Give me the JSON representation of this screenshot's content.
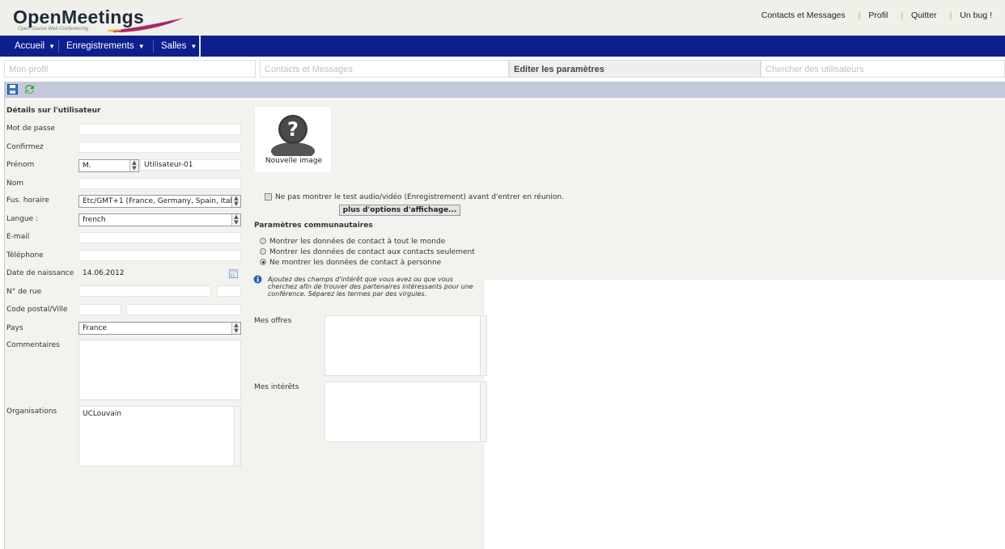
{
  "header": {
    "logo_title": "OpenMeetings",
    "logo_subtitle": "Open-Source Web-Conferencing",
    "links": [
      "Contacts et Messages",
      "Profil",
      "Quitter",
      "Un bug !"
    ]
  },
  "nav": {
    "items": [
      "Accueil",
      "Enregistrements",
      "Salles"
    ]
  },
  "tabs": [
    "Mon profil",
    "Contacts et Messages",
    "Editer les paramètres",
    "Chercher des utilisateurs"
  ],
  "active_tab": "Editer les paramètres",
  "toolbar": {
    "icons": [
      "save-icon",
      "refresh-icon"
    ]
  },
  "form": {
    "section_title": "Détails sur l'utilisateur",
    "password_label": "Mot de passe",
    "confirm_label": "Confirmez",
    "firstname_label": "Prénom",
    "salutation_value": "M.",
    "firstname_value": "Utilisateur-01",
    "lastname_label": "Nom",
    "timezone_label": "Fus. horaire",
    "timezone_value": "Etc/GMT+1 (France, Germany, Spain, Italy",
    "language_label": "Langue :",
    "language_value": "french",
    "email_label": "E-mail",
    "phone_label": "Téléphone",
    "birthdate_label": "Date de naissance",
    "birthdate_value": "14.06.2012",
    "street_label": "N° de rue",
    "zipcity_label": "Code postal/Ville",
    "country_label": "Pays",
    "country_value": "France",
    "comments_label": "Commentaires",
    "organisations_label": "Organisations",
    "organisations_value": "UCLouvain"
  },
  "profile": {
    "new_image_label": "Nouvelle image",
    "skip_av_test_label": "Ne pas montrer le test audio/vidéo (Enregistrement) avant d'entrer en réunion.",
    "more_options_button": "plus d'options d'affichage...",
    "community_title": "Paramètres communautaires",
    "radio_options": [
      "Montrer les données de contact à tout le monde",
      "Montrer les données de contact aux contacts seulement",
      "Ne montrer les données de contact à personne"
    ],
    "selected_radio": 2,
    "info_lines": [
      "Ajoutez des champs d'intérêt que vous avez ou que vous",
      "cherchez afin de trouver des partenaires intéressants pour une",
      "conférence. Séparez les termes par des virgules."
    ],
    "offers_label": "Mes offres",
    "interests_label": "Mes intérêts"
  },
  "colors": {
    "nav_bg": "#0d1f8f",
    "toolbar_bg": "#c3c9dc",
    "page_bg": "#f2f2ee",
    "separator": "#f0a020"
  }
}
